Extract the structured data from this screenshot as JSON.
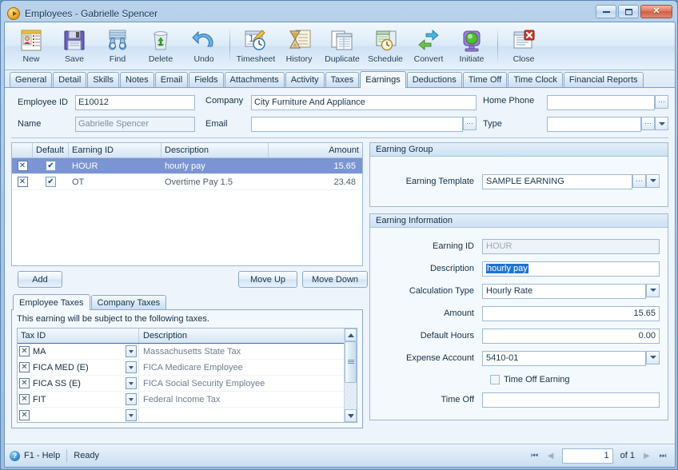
{
  "window": {
    "title": "Employees - Gabrielle Spencer",
    "icon": "play-circle-icon",
    "buttons": {
      "minimize": "minimize-icon",
      "maximize": "maximize-icon",
      "close": "✕"
    }
  },
  "toolbar": {
    "items": [
      {
        "label": "New",
        "icon": "new-document-icon"
      },
      {
        "label": "Save",
        "icon": "floppy-disk-icon"
      },
      {
        "label": "Find",
        "icon": "binoculars-icon"
      },
      {
        "label": "Delete",
        "icon": "recycle-bin-icon"
      },
      {
        "label": "Undo",
        "icon": "undo-arrow-icon"
      },
      {
        "label": "Timesheet",
        "icon": "timesheet-clock-icon"
      },
      {
        "label": "History",
        "icon": "hourglass-history-icon"
      },
      {
        "label": "Duplicate",
        "icon": "duplicate-pages-icon"
      },
      {
        "label": "Schedule",
        "icon": "schedule-calendar-icon"
      },
      {
        "label": "Convert",
        "icon": "convert-arrows-icon"
      },
      {
        "label": "Initiate",
        "icon": "traffic-light-icon"
      },
      {
        "label": "Close",
        "icon": "close-document-icon"
      }
    ]
  },
  "tabs": [
    {
      "label": "General",
      "active": false
    },
    {
      "label": "Detail",
      "active": false
    },
    {
      "label": "Skills",
      "active": false
    },
    {
      "label": "Notes",
      "active": false
    },
    {
      "label": "Email",
      "active": false
    },
    {
      "label": "Fields",
      "active": false
    },
    {
      "label": "Attachments",
      "active": false
    },
    {
      "label": "Activity",
      "active": false
    },
    {
      "label": "Taxes",
      "active": false
    },
    {
      "label": "Earnings",
      "active": true
    },
    {
      "label": "Deductions",
      "active": false
    },
    {
      "label": "Time Off",
      "active": false
    },
    {
      "label": "Time Clock",
      "active": false
    },
    {
      "label": "Financial Reports",
      "active": false
    }
  ],
  "header_fields": {
    "employee_id": {
      "label": "Employee ID",
      "value": "E10012"
    },
    "name": {
      "label": "Name",
      "value": "Gabrielle Spencer"
    },
    "company": {
      "label": "Company",
      "value": "City Furniture And Appliance"
    },
    "email": {
      "label": "Email",
      "value": ""
    },
    "home_phone": {
      "label": "Home Phone",
      "value": ""
    },
    "type": {
      "label": "Type",
      "value": ""
    }
  },
  "earnings_grid": {
    "columns": [
      "",
      "Default",
      "Earning ID",
      "Description",
      "Amount"
    ],
    "rows": [
      {
        "delete": "✕",
        "default": "✔",
        "earning_id": "HOUR",
        "description": "hourly pay",
        "amount": "15.65",
        "selected": true
      },
      {
        "delete": "✕",
        "default": "✔",
        "earning_id": "OT",
        "description": "Overtime Pay 1.5",
        "amount": "23.48",
        "selected": false
      }
    ]
  },
  "grid_buttons": {
    "add": "Add",
    "move_up": "Move Up",
    "move_down": "Move Down"
  },
  "tax_tabs": [
    {
      "label": "Employee Taxes",
      "active": true
    },
    {
      "label": "Company Taxes",
      "active": false
    }
  ],
  "tax_panel": {
    "note": "This earning will be subject to the following taxes.",
    "columns": [
      "Tax ID",
      "Description"
    ],
    "rows": [
      {
        "delete": "✕",
        "tax_id": "MA",
        "description": "Massachusetts State Tax"
      },
      {
        "delete": "✕",
        "tax_id": "FICA MED (E)",
        "description": "FICA Medicare Employee"
      },
      {
        "delete": "✕",
        "tax_id": "FICA SS (E)",
        "description": "FICA Social Security Employee"
      },
      {
        "delete": "✕",
        "tax_id": "FIT",
        "description": "Federal Income Tax"
      },
      {
        "delete": "✕",
        "tax_id": "",
        "description": ""
      }
    ]
  },
  "earning_group": {
    "title": "Earning Group",
    "template": {
      "label": "Earning Template",
      "value": "SAMPLE EARNING"
    }
  },
  "earning_information": {
    "title": "Earning Information",
    "earning_id": {
      "label": "Earning ID",
      "value": "HOUR"
    },
    "description": {
      "label": "Description",
      "value": "hourly pay"
    },
    "calculation_type": {
      "label": "Calculation Type",
      "value": "Hourly Rate"
    },
    "amount": {
      "label": "Amount",
      "value": "15.65"
    },
    "default_hours": {
      "label": "Default Hours",
      "value": "0.00"
    },
    "expense_account": {
      "label": "Expense Account",
      "value": "5410-01"
    },
    "time_off_earning": {
      "label": "Time Off Earning",
      "checked": false
    },
    "time_off": {
      "label": "Time Off",
      "value": ""
    }
  },
  "statusbar": {
    "help": "F1 - Help",
    "status": "Ready",
    "page_value": "1",
    "of_pages": "of 1"
  }
}
